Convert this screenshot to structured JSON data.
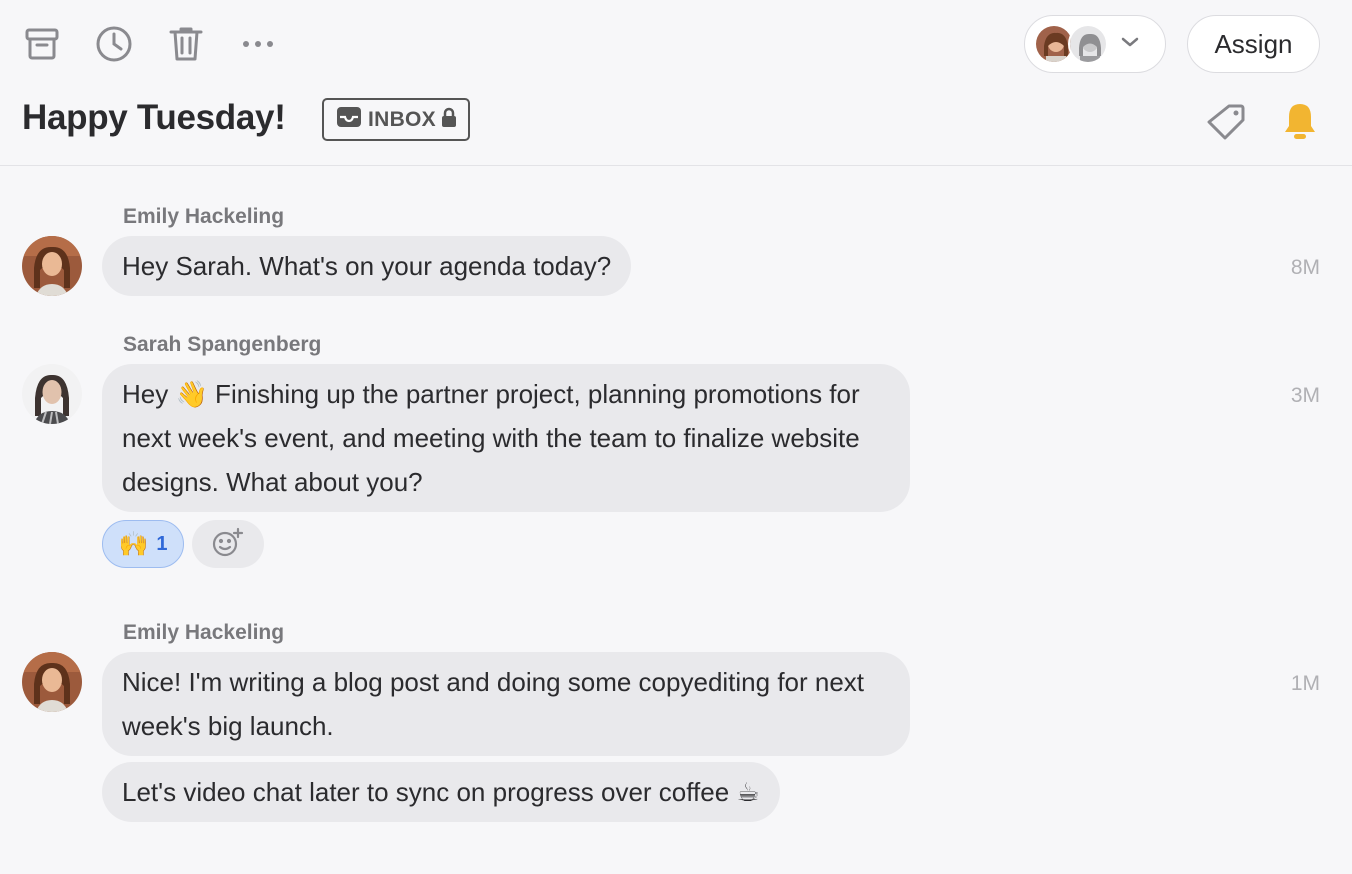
{
  "toolbar": {
    "archive_icon": "archive-icon",
    "snooze_icon": "clock-icon",
    "trash_icon": "trash-icon",
    "more_icon": "more-icon",
    "assign_label": "Assign"
  },
  "header": {
    "title": "Happy Tuesday!",
    "inbox_label": "INBOX",
    "bell_color": "#F2B531"
  },
  "messages": [
    {
      "author": "Emily Hackeling",
      "bubbles": [
        "Hey Sarah. What's on your agenda today?"
      ],
      "time": "8M"
    },
    {
      "author": "Sarah Spangenberg",
      "bubbles": [
        "Hey 👋 Finishing up the partner project, planning promotions for next week's event, and meeting with the team to finalize website designs. What about you?"
      ],
      "time": "3M",
      "reaction": {
        "emoji": "🙌",
        "count": "1"
      }
    },
    {
      "author": "Emily Hackeling",
      "bubbles": [
        "Nice! I'm writing a blog post and doing some copyediting for next week's big launch.",
        "Let's video chat later to sync on progress over coffee ☕"
      ],
      "time": "1M"
    }
  ]
}
